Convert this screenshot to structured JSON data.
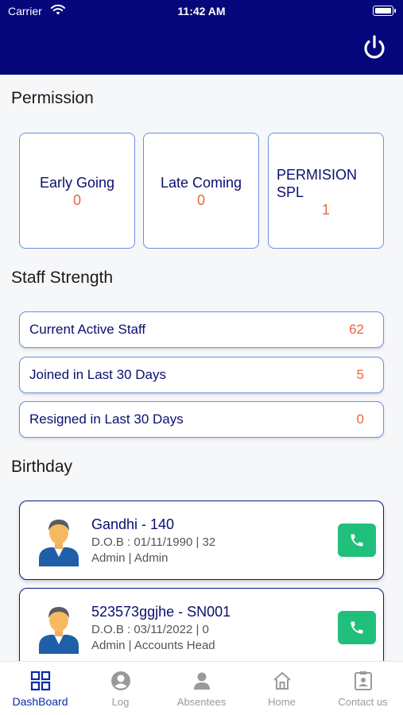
{
  "status_bar": {
    "carrier": "Carrier",
    "time": "11:42 AM"
  },
  "navbar": {
    "power_icon": "power-icon"
  },
  "colors": {
    "header": "#05077a",
    "accent_orange": "#e8673c",
    "card_border": "#6b8fe0",
    "call_green": "#20bf7b",
    "active_tab": "#0d2aa5"
  },
  "permission": {
    "title": "Permission",
    "cards": [
      {
        "label": "Early Going",
        "value": "0"
      },
      {
        "label": "Late Coming",
        "value": "0"
      },
      {
        "label": "PERMISION SPL",
        "value": "1"
      }
    ]
  },
  "staff_strength": {
    "title": "Staff Strength",
    "rows": [
      {
        "label": "Current Active Staff",
        "value": "62"
      },
      {
        "label": "Joined in Last 30 Days",
        "value": "5"
      },
      {
        "label": "Resigned in Last 30 Days",
        "value": "0"
      }
    ]
  },
  "birthday": {
    "title": "Birthday",
    "entries": [
      {
        "name": "Gandhi  - 140",
        "dob": "D.O.B : 01/11/1990 | 32",
        "role": "Admin | Admin",
        "icon": "phone-icon"
      },
      {
        "name": "523573ggjhe - SN001",
        "dob": "D.O.B : 03/11/2022 | 0",
        "role": "Admin | Accounts Head",
        "icon": "phone-icon"
      }
    ]
  },
  "tabs": [
    {
      "label": "DashBoard",
      "icon": "dashboard-icon",
      "active": true
    },
    {
      "label": "Log",
      "icon": "user-circle-icon",
      "active": false
    },
    {
      "label": "Absentees",
      "icon": "person-icon",
      "active": false
    },
    {
      "label": "Home",
      "icon": "home-icon",
      "active": false
    },
    {
      "label": "Contact us",
      "icon": "contact-card-icon",
      "active": false
    }
  ]
}
